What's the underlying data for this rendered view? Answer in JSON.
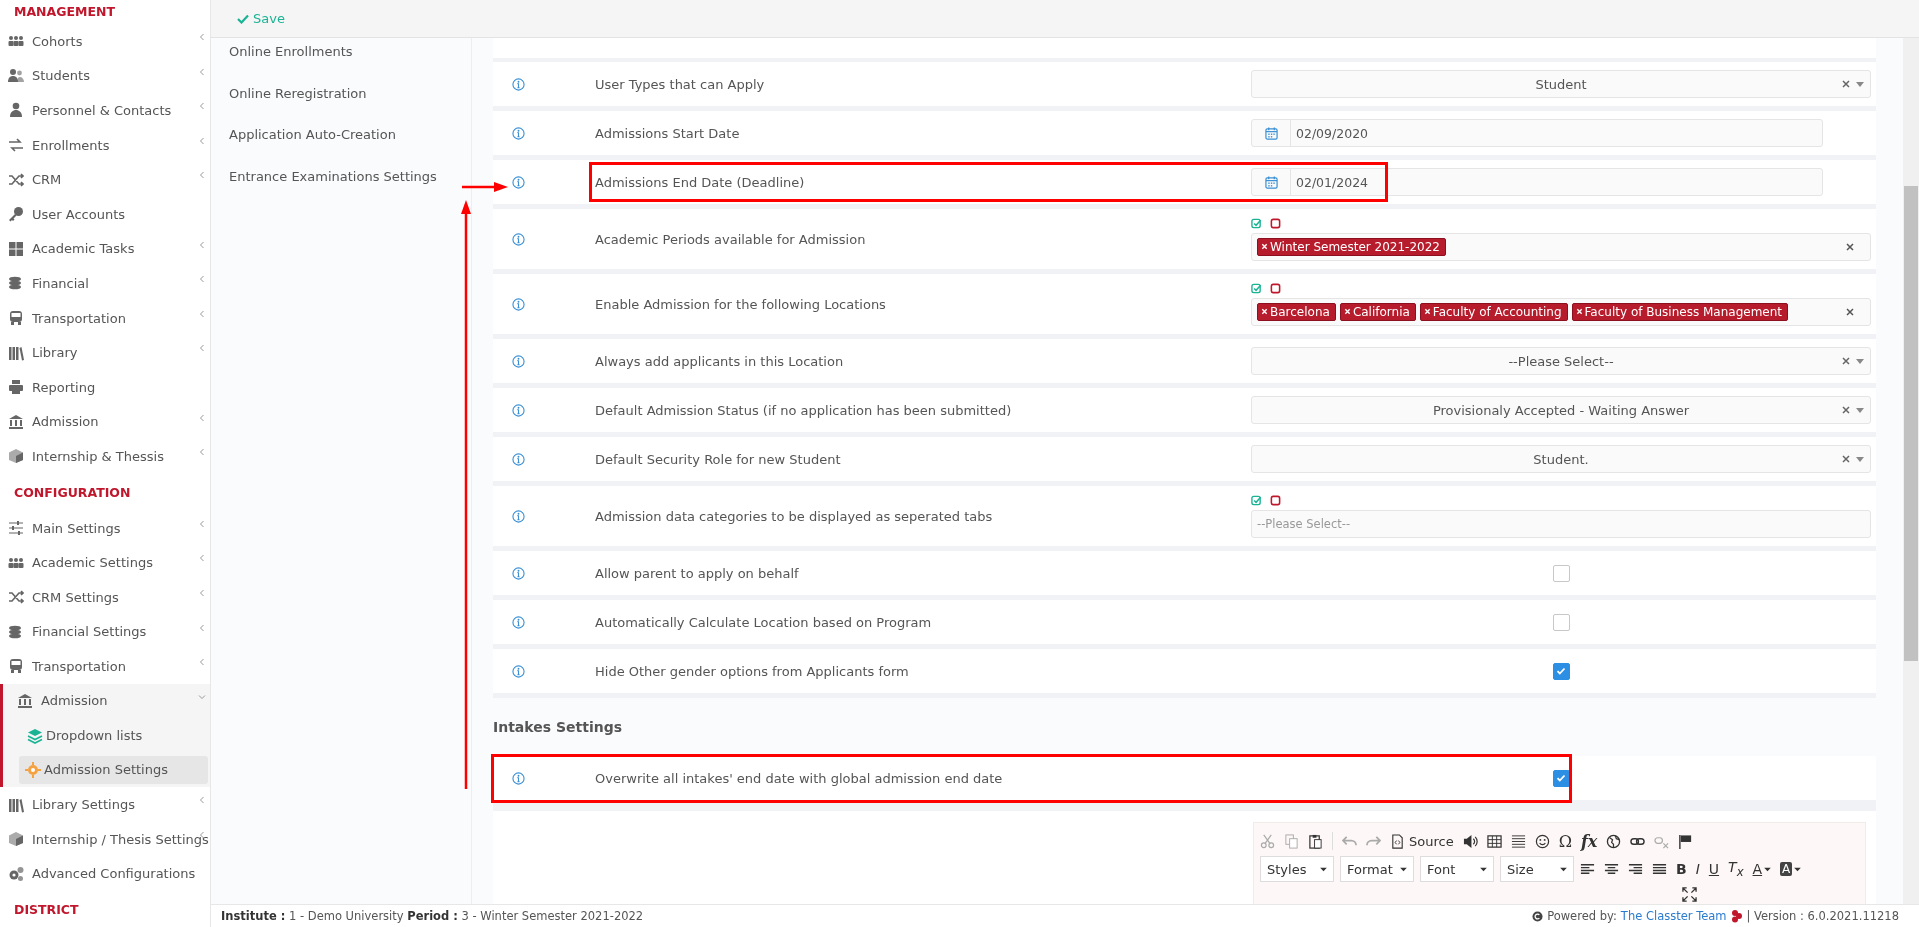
{
  "sidebar": {
    "sections": [
      {
        "heading": "MANAGEMENT",
        "items": [
          {
            "label": "Cohorts",
            "has_submenu": true,
            "expanded": false,
            "selected": false
          },
          {
            "label": "Students",
            "has_submenu": true,
            "expanded": false,
            "selected": false
          },
          {
            "label": "Personnel & Contacts",
            "has_submenu": true,
            "expanded": false,
            "selected": false
          },
          {
            "label": "Enrollments",
            "has_submenu": true,
            "expanded": false,
            "selected": false
          },
          {
            "label": "CRM",
            "has_submenu": true,
            "expanded": false,
            "selected": false
          },
          {
            "label": "User Accounts",
            "has_submenu": false,
            "selected": false
          },
          {
            "label": "Academic Tasks",
            "has_submenu": true,
            "expanded": false,
            "selected": false
          },
          {
            "label": "Financial",
            "has_submenu": true,
            "expanded": false,
            "selected": false
          },
          {
            "label": "Transportation",
            "has_submenu": true,
            "expanded": false,
            "selected": false
          },
          {
            "label": "Library",
            "has_submenu": true,
            "expanded": false,
            "selected": false
          },
          {
            "label": "Reporting",
            "has_submenu": false,
            "selected": false
          },
          {
            "label": "Admission",
            "has_submenu": true,
            "expanded": false,
            "selected": false
          },
          {
            "label": "Internship & Thessis",
            "has_submenu": true,
            "expanded": false,
            "selected": false
          }
        ]
      },
      {
        "heading": "CONFIGURATION",
        "items": [
          {
            "label": "Main Settings",
            "has_submenu": true,
            "expanded": false,
            "selected": false
          },
          {
            "label": "Academic Settings",
            "has_submenu": true,
            "expanded": false,
            "selected": false
          },
          {
            "label": "CRM Settings",
            "has_submenu": true,
            "expanded": false,
            "selected": false
          },
          {
            "label": "Financial Settings",
            "has_submenu": true,
            "expanded": false,
            "selected": false
          },
          {
            "label": "Transportation",
            "has_submenu": true,
            "expanded": false,
            "selected": false
          },
          {
            "label": "Admission",
            "has_submenu": true,
            "expanded": true,
            "selected": false,
            "children": [
              {
                "label": "Dropdown lists",
                "selected": false
              },
              {
                "label": "Admission Settings",
                "selected": true
              }
            ]
          },
          {
            "label": "Library Settings",
            "has_submenu": true,
            "expanded": false,
            "selected": false
          },
          {
            "label": "Internship / Thesis Settings",
            "has_submenu": true,
            "expanded": false,
            "selected": false
          },
          {
            "label": "Advanced Configurations",
            "has_submenu": false,
            "selected": false
          }
        ]
      },
      {
        "heading": "DISTRICT"
      }
    ]
  },
  "toolbar": {
    "save_label": "Save"
  },
  "subnav": [
    "Online Enrollments",
    "Online Reregistration",
    "Application Auto-Creation",
    "Entrance Examinations Settings"
  ],
  "settings": [
    {
      "kind": "select",
      "label": "User Types that can Apply",
      "value": "Student",
      "highlighted": false
    },
    {
      "kind": "date",
      "label": "Admissions Start Date",
      "value": "02/09/2020",
      "highlighted": false
    },
    {
      "kind": "date",
      "label": "Admissions End Date (Deadline)",
      "value": "02/01/2024",
      "highlighted": true
    },
    {
      "kind": "tags",
      "label": "Academic Periods available for Admission",
      "tags": [
        "Winter Semester 2021-2022"
      ],
      "highlighted": false
    },
    {
      "kind": "tags",
      "label": "Enable Admission for the following Locations",
      "tags": [
        "Barcelona",
        "California",
        "Faculty of Accounting",
        "Faculty of Business Management"
      ],
      "highlighted": false
    },
    {
      "kind": "select",
      "label": "Always add applicants in this Location",
      "value": "--Please Select--",
      "highlighted": false
    },
    {
      "kind": "select",
      "label": "Default Admission Status (if no application has been submitted)",
      "value": "Provisionaly Accepted - Waiting Answer",
      "highlighted": false
    },
    {
      "kind": "select",
      "label": "Default Security Role for new Student",
      "value": "Student.",
      "highlighted": false
    },
    {
      "kind": "tags",
      "label": "Admission data categories to be displayed as seperated tabs",
      "placeholder": "--Please Select--",
      "highlighted": false
    },
    {
      "kind": "checkbox",
      "label": "Allow parent to apply on behalf",
      "checked": false,
      "highlighted": false
    },
    {
      "kind": "checkbox",
      "label": "Automatically Calculate Location based on Program",
      "checked": false,
      "highlighted": false
    },
    {
      "kind": "checkbox",
      "label": "Hide Other gender options from Applicants form",
      "checked": true,
      "highlighted": false
    }
  ],
  "intakes": {
    "heading": "Intakes Settings",
    "settings": [
      {
        "kind": "checkbox",
        "label": "Overwrite all intakes' end date with global admission end date",
        "checked": true,
        "highlighted": true
      }
    ]
  },
  "editor": {
    "source_label": "Source",
    "symbol_label": "Ω",
    "formula_label": "fx",
    "dropdowns": [
      "Styles",
      "Format",
      "Font",
      "Size"
    ],
    "format_buttons": [
      "B",
      "I",
      "U",
      "T$_{x}$"
    ],
    "text_color_label": "A",
    "background_color_label": "A"
  },
  "footer": {
    "context": "**Institute :** 1 - Demo University **Period :** 3 - Winter Semester 2021-2022",
    "powered_label": "Powered by:",
    "powered_link": "The Classter Team",
    "version": "| Version : 6.0.2021.11218"
  }
}
